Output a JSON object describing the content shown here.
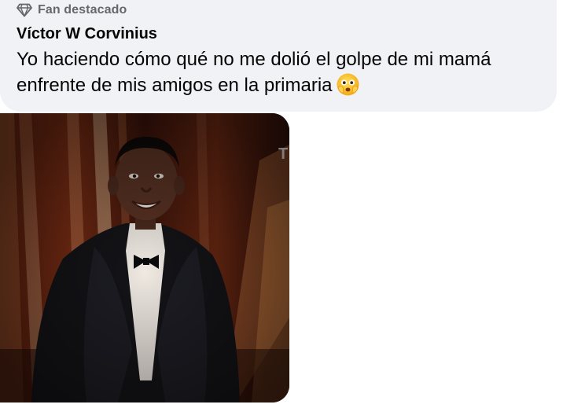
{
  "comment": {
    "badge": {
      "icon": "diamond-icon",
      "label": "Fan destacado"
    },
    "author": "Víctor W Corvinius",
    "text": "Yo haciendo cómo qué no me dolió el golpe de mi mamá enfrente de mis amigos en la primaria",
    "emoji": "flushed-face-hands-emoji"
  },
  "media": {
    "type": "photo",
    "subject": "man-in-tuxedo-on-stage"
  },
  "colors": {
    "bubble": "#f0f2f5",
    "muted_text": "#65676b",
    "primary_text": "#050505"
  }
}
